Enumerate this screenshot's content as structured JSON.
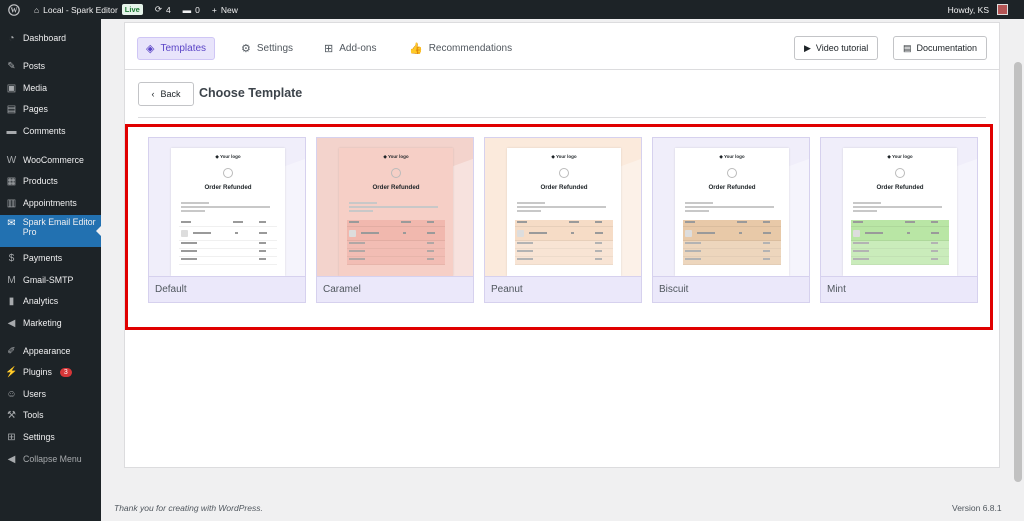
{
  "adminbar": {
    "site_name": "Local - Spark Editor",
    "live_label": "Live",
    "updates_count": "4",
    "comments_count": "0",
    "new_label": "New",
    "howdy": "Howdy, KS"
  },
  "sidebar": {
    "items": [
      {
        "label": "Dashboard",
        "icon": "dashboard-icon"
      },
      {
        "label": "Posts",
        "icon": "pin-icon"
      },
      {
        "label": "Media",
        "icon": "media-icon"
      },
      {
        "label": "Pages",
        "icon": "pages-icon"
      },
      {
        "label": "Comments",
        "icon": "comments-icon"
      },
      {
        "label": "WooCommerce",
        "icon": "woo-icon"
      },
      {
        "label": "Products",
        "icon": "products-icon"
      },
      {
        "label": "Appointments",
        "icon": "calendar-icon"
      },
      {
        "label": "Spark Email Editor Pro",
        "icon": "email-icon"
      },
      {
        "label": "Payments",
        "icon": "payments-icon"
      },
      {
        "label": "Gmail-SMTP",
        "icon": "gmail-icon"
      },
      {
        "label": "Analytics",
        "icon": "analytics-icon"
      },
      {
        "label": "Marketing",
        "icon": "marketing-icon"
      },
      {
        "label": "Appearance",
        "icon": "brush-icon"
      },
      {
        "label": "Plugins",
        "icon": "plugin-icon",
        "badge": "3"
      },
      {
        "label": "Users",
        "icon": "users-icon"
      },
      {
        "label": "Tools",
        "icon": "tools-icon"
      },
      {
        "label": "Settings",
        "icon": "settings-icon"
      },
      {
        "label": "Collapse Menu",
        "icon": "collapse-icon"
      }
    ]
  },
  "tabs": [
    {
      "label": "Templates",
      "icon": "layers-icon"
    },
    {
      "label": "Settings",
      "icon": "gear-icon"
    },
    {
      "label": "Add-ons",
      "icon": "addons-icon"
    },
    {
      "label": "Recommendations",
      "icon": "thumbs-up-icon"
    }
  ],
  "header_buttons": {
    "video_tutorial": "Video tutorial",
    "documentation": "Documentation"
  },
  "back_label": "Back",
  "page_title": "Choose Template",
  "template_preview": {
    "logo_text": "Your logo",
    "heading": "Order Refunded"
  },
  "templates": [
    {
      "name": "Default",
      "header_color": "#ffffff",
      "page_color": "#f0eefa",
      "accent": "#e3defa"
    },
    {
      "name": "Caramel",
      "header_color": "#f6cfc6",
      "page_color": "#f3d3cc",
      "accent": "#f1b8ae"
    },
    {
      "name": "Peanut",
      "header_color": "#ffffff",
      "page_color": "#fbeadc",
      "accent": "#f6dcc6"
    },
    {
      "name": "Biscuit",
      "header_color": "#ffffff",
      "page_color": "#f0eefa",
      "accent": "#e8c9a8"
    },
    {
      "name": "Mint",
      "header_color": "#ffffff",
      "page_color": "#f0eefa",
      "accent": "#b9e6a5"
    }
  ],
  "footer": {
    "thanks": "Thank you for creating with WordPress.",
    "version": "Version 6.8.1"
  }
}
